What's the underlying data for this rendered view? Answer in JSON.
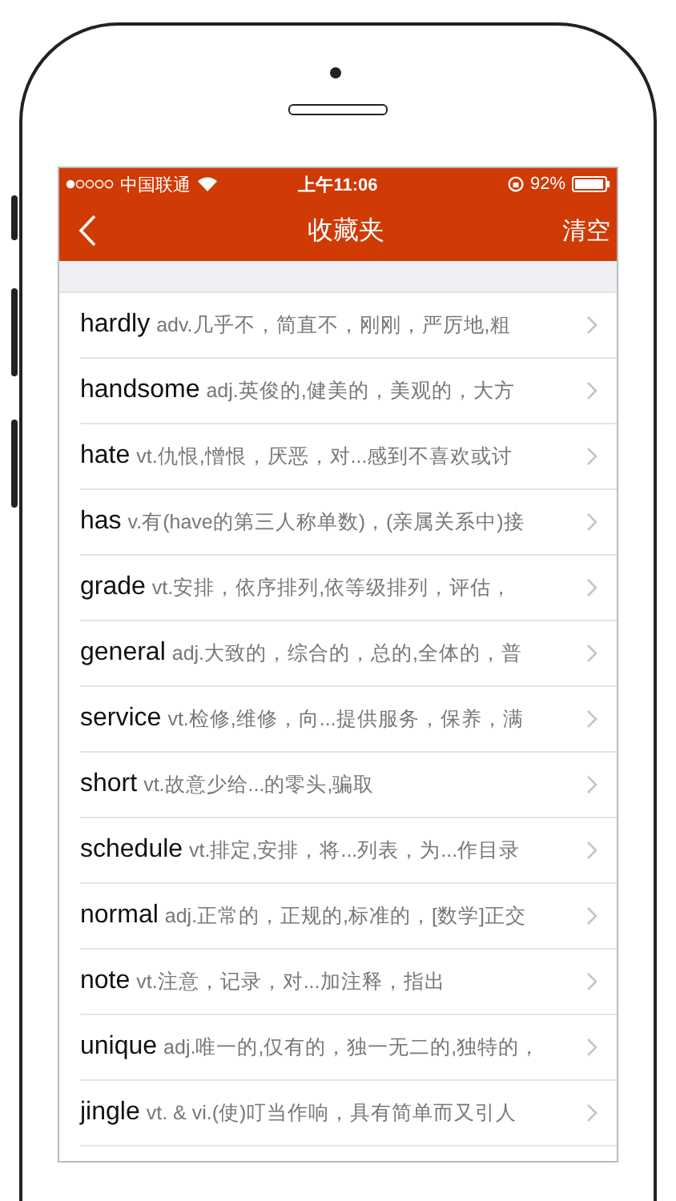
{
  "status_bar": {
    "carrier": "中国联通",
    "time": "上午11:06",
    "battery": "92%"
  },
  "nav_bar": {
    "title": "收藏夹",
    "action": "清空"
  },
  "words": [
    {
      "word": "hardly",
      "definition": "adv.几乎不，简直不，刚刚，严厉地,粗"
    },
    {
      "word": "handsome",
      "definition": "adj.英俊的,健美的，美观的，大方"
    },
    {
      "word": "hate",
      "definition": "vt.仇恨,憎恨，厌恶，对...感到不喜欢或讨"
    },
    {
      "word": "has",
      "definition": "v.有(have的第三人称单数)，(亲属关系中)接"
    },
    {
      "word": "grade",
      "definition": "vt.安排，依序排列,依等级排列，评估，"
    },
    {
      "word": "general",
      "definition": "adj.大致的，综合的，总的,全体的，普"
    },
    {
      "word": "service",
      "definition": "vt.检修,维修，向...提供服务，保养，满"
    },
    {
      "word": "short",
      "definition": "vt.故意少给...的零头,骗取"
    },
    {
      "word": "schedule",
      "definition": "vt.排定,安排，将...列表，为...作目录"
    },
    {
      "word": "normal",
      "definition": "adj.正常的，正规的,标准的，[数学]正交"
    },
    {
      "word": "note",
      "definition": "vt.注意，记录，对...加注释，指出"
    },
    {
      "word": "unique",
      "definition": "adj.唯一的,仅有的，独一无二的,独特的，"
    },
    {
      "word": "jingle",
      "definition": "vt. & vi.(使)叮当作响，具有简单而又引人"
    }
  ]
}
